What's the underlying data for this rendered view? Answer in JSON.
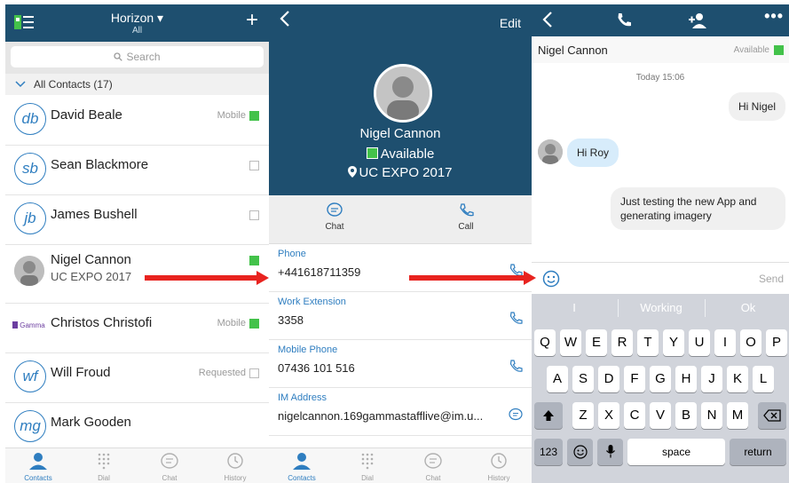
{
  "contacts_screen": {
    "header": {
      "title": "Horizon ▾",
      "subtitle": "All",
      "add_label": "+"
    },
    "search_placeholder": "Search",
    "group_label": "All Contacts (17)",
    "contacts": [
      {
        "initials": "db",
        "name": "David Beale",
        "status": "Mobile",
        "presence": "green"
      },
      {
        "initials": "sb",
        "name": "Sean Blackmore",
        "status": "",
        "presence": "empty"
      },
      {
        "initials": "jb",
        "name": "James Bushell",
        "status": "",
        "presence": "empty"
      },
      {
        "initials": "",
        "name": "Nigel Cannon",
        "subtitle": "UC EXPO 2017",
        "status": "",
        "presence": "green"
      },
      {
        "initials": "",
        "logo_text": "Gamma",
        "name": "Christos Christofi",
        "status": "Mobile",
        "presence": "green"
      },
      {
        "initials": "wf",
        "name": "Will Froud",
        "status": "Requested",
        "presence": "requested"
      },
      {
        "initials": "mg",
        "name": "Mark Gooden",
        "status": "",
        "presence": "none"
      }
    ]
  },
  "tabs": [
    {
      "label": "Contacts",
      "icon": "person-icon",
      "active": true
    },
    {
      "label": "Dial",
      "icon": "dialpad-icon",
      "active": false
    },
    {
      "label": "Chat",
      "icon": "chat-icon",
      "active": false
    },
    {
      "label": "History",
      "icon": "history-icon",
      "active": false
    }
  ],
  "detail_screen": {
    "edit_label": "Edit",
    "name": "Nigel Cannon",
    "availability": "Available",
    "location": "UC EXPO 2017",
    "actions": [
      {
        "label": "Chat",
        "icon": "chat-icon"
      },
      {
        "label": "Call",
        "icon": "phone-icon"
      }
    ],
    "fields": [
      {
        "label": "Phone",
        "value": "+441618711359",
        "icon": "phone-icon"
      },
      {
        "label": "Work Extension",
        "value": "3358",
        "icon": "phone-icon"
      },
      {
        "label": "Mobile Phone",
        "value": "07436 101 516",
        "icon": "phone-icon"
      },
      {
        "label": "IM Address",
        "value": "nigelcannon.169gammastafflive@im.u...",
        "icon": "chat-icon"
      }
    ]
  },
  "chat_screen": {
    "contact_name": "Nigel Cannon",
    "contact_status": "Available",
    "timestamp": "Today 15:06",
    "messages": [
      {
        "direction": "out",
        "text": "Hi Nigel"
      },
      {
        "direction": "in",
        "text": "Hi Roy"
      },
      {
        "direction": "out",
        "text": "Just testing the new App and generating imagery"
      }
    ],
    "send_label": "Send",
    "predictions": [
      "I",
      "Working",
      "Ok"
    ],
    "keyboard": {
      "row1": [
        "Q",
        "W",
        "E",
        "R",
        "T",
        "Y",
        "U",
        "I",
        "O",
        "P"
      ],
      "row2": [
        "A",
        "S",
        "D",
        "F",
        "G",
        "H",
        "J",
        "K",
        "L"
      ],
      "row3": [
        "Z",
        "X",
        "C",
        "V",
        "B",
        "N",
        "M"
      ],
      "key_123": "123",
      "key_space": "space",
      "key_return": "return"
    }
  },
  "colors": {
    "header": "#1e4f6f",
    "accent": "#2f7ec0",
    "presence_green": "#43c24a",
    "arrow": "#e8231f"
  }
}
